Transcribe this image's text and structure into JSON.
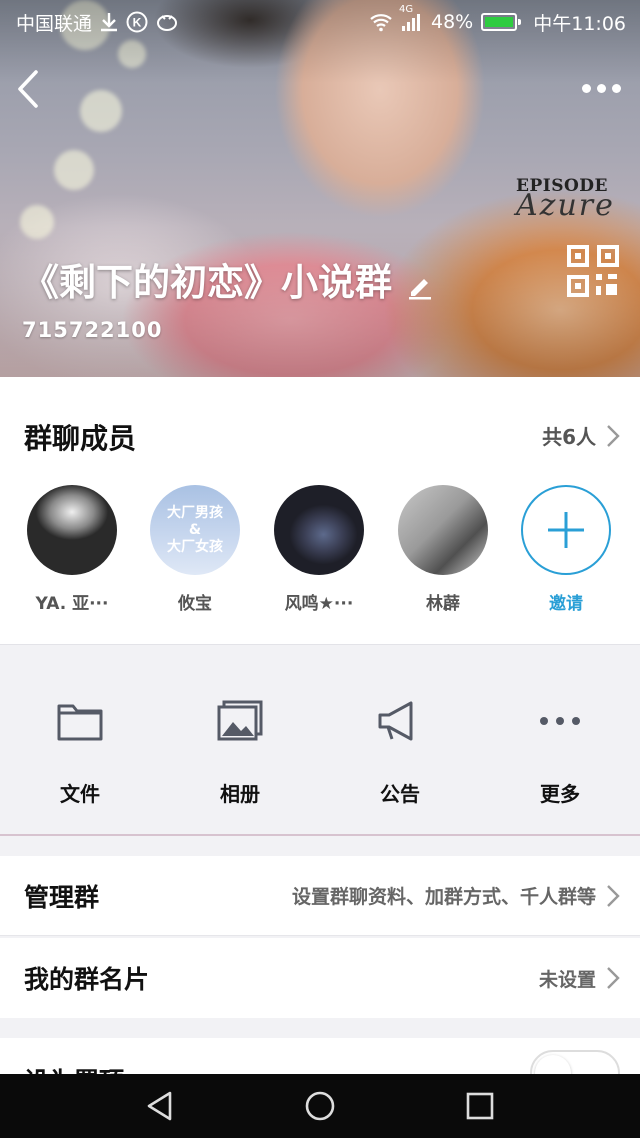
{
  "status_bar": {
    "carrier": "中国联通",
    "network": "4G",
    "battery": "48%",
    "time": "中午11:06"
  },
  "header": {
    "group_name": "《剩下的初恋》小说群",
    "group_id": "715722100",
    "watermark_top": "EPISODE",
    "watermark_script": "Azure"
  },
  "members": {
    "title": "群聊成员",
    "count_label": "共6人",
    "items": [
      {
        "name": "YA. 亚···",
        "avatar_caption": ""
      },
      {
        "name": "攸宝",
        "avatar_caption": [
          "大厂男孩",
          "&",
          "大厂女孩"
        ]
      },
      {
        "name": "风鸣★···",
        "avatar_caption": ""
      },
      {
        "name": "林薜",
        "avatar_caption": ""
      }
    ],
    "invite_label": "邀请"
  },
  "actions": [
    {
      "label": "文件",
      "icon": "folder-icon"
    },
    {
      "label": "相册",
      "icon": "photo-album-icon"
    },
    {
      "label": "公告",
      "icon": "megaphone-icon"
    },
    {
      "label": "更多",
      "icon": "more-dots-icon"
    }
  ],
  "settings": {
    "manage": {
      "title": "管理群",
      "value": "设置群聊资料、加群方式、千人群等"
    },
    "card": {
      "title": "我的群名片",
      "value": "未设置"
    },
    "pin": {
      "title": "设为置顶"
    }
  },
  "colors": {
    "accent": "#2a9fd6",
    "battery_fill": "#2ecc40"
  }
}
